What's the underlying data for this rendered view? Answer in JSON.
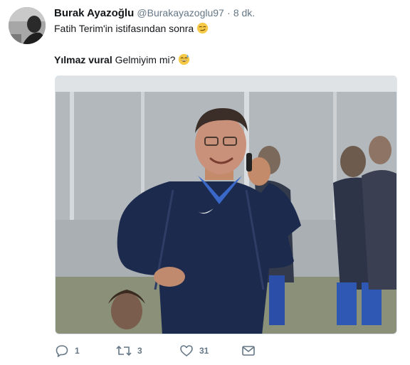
{
  "tweet": {
    "display_name": "Burak Ayazoğlu",
    "handle": "@Burakayazoglu97",
    "separator": "·",
    "time": "8 dk.",
    "line1_text": "Fatih Terim'in istifasından sonra",
    "line2_bold": "Yılmaz vural",
    "line2_text": " Gelmiyim mi?",
    "emoji1": "smirk-face-icon",
    "emoji2": "grinning-sweat-face-icon"
  },
  "actions": {
    "reply_count": "1",
    "retweet_count": "3",
    "like_count": "31"
  },
  "colors": {
    "text": "#14171a",
    "secondary": "#657786",
    "border": "#e1e8ed",
    "jacket": "#1c2a4e"
  }
}
